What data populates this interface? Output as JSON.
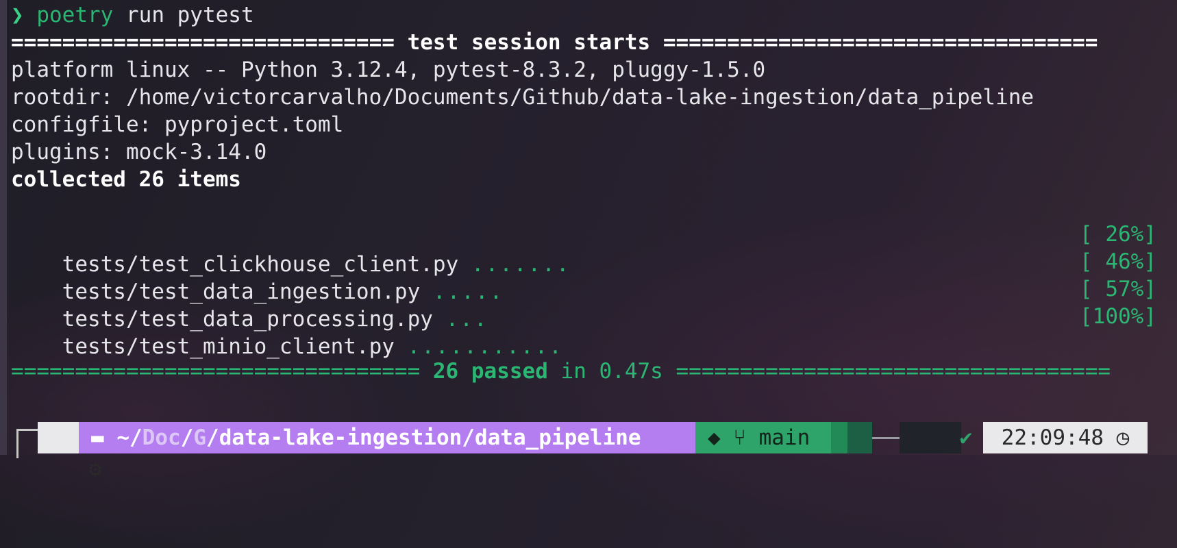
{
  "prompt": {
    "symbol": "❯",
    "command": "poetry",
    "args": " run pytest"
  },
  "session": {
    "header_left": "==============================",
    "header_title": " test session starts ",
    "header_right": "==================================",
    "platform": "platform linux -- Python 3.12.4, pytest-8.3.2, pluggy-1.5.0",
    "rootdir": "rootdir: /home/victorcarvalho/Documents/Github/data-lake-ingestion/data_pipeline",
    "configfile": "configfile: pyproject.toml",
    "plugins": "plugins: mock-3.14.0",
    "collected": "collected 26 items"
  },
  "tests": [
    {
      "file": "tests/test_clickhouse_client.py",
      "dots": ".......",
      "progress": "[ 26%]"
    },
    {
      "file": "tests/test_data_ingestion.py",
      "dots": ".....",
      "progress": "[ 46%]"
    },
    {
      "file": "tests/test_data_processing.py",
      "dots": "...",
      "progress": "[ 57%]"
    },
    {
      "file": "tests/test_minio_client.py",
      "dots": "...........",
      "progress": "[100%]"
    }
  ],
  "summary": {
    "left": "================================",
    "passed": " 26 passed",
    "time": " in 0.47s ",
    "right": "=================================="
  },
  "statusbar": {
    "os_icon": "⚙",
    "os_icon_name": "fedora-icon",
    "folder_icon": "▬",
    "path_home": "~/",
    "path_doc": "Doc",
    "path_sep1": "/",
    "path_g": "G",
    "path_sep2": "/",
    "path_rest": "data-lake-ingestion/data_pipeline",
    "github_icon": "◆",
    "branch_icon": "⑂",
    "branch": "main",
    "check": "✔",
    "time": "22:09:48",
    "clock_icon": "◷"
  },
  "colors": {
    "green": "#2bb673",
    "path_purple": "#b57ef0",
    "git_green": "#2ea36a"
  }
}
